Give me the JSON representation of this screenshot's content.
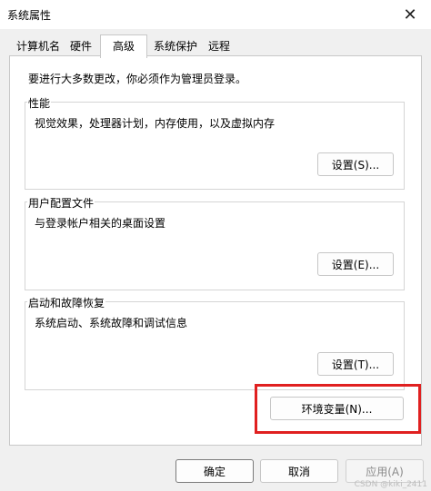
{
  "window": {
    "title": "系统属性",
    "close_icon": "✕"
  },
  "tabs": [
    "计算机名",
    "硬件",
    "高级",
    "系统保护",
    "远程"
  ],
  "active_tab": "高级",
  "warning": "要进行大多数更改，你必须作为管理员登录。",
  "groups": {
    "performance": {
      "title": "性能",
      "desc": "视觉效果，处理器计划，内存使用，以及虚拟内存",
      "button": "设置(S)..."
    },
    "profiles": {
      "title": "用户配置文件",
      "desc": "与登录帐户相关的桌面设置",
      "button": "设置(E)..."
    },
    "startup": {
      "title": "启动和故障恢复",
      "desc": "系统启动、系统故障和调试信息",
      "button": "设置(T)..."
    }
  },
  "env_button": "环境变量(N)...",
  "footer": {
    "ok": "确定",
    "cancel": "取消",
    "apply": "应用(A)"
  },
  "watermark": "CSDN @kiki_2411",
  "colors": {
    "highlight": "#e02020",
    "window_bg": "#f0f0f0"
  }
}
